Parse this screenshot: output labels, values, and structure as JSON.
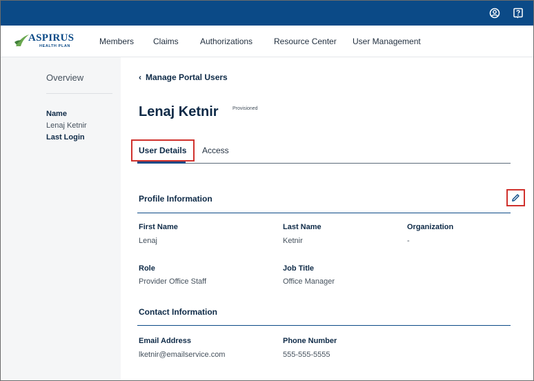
{
  "topbar": {
    "account_icon": "user-circle-icon",
    "help_icon": "help-icon",
    "color": "#0b4a87"
  },
  "brand": {
    "name": "ASPIRUS",
    "sub": "HEALTH PLAN"
  },
  "nav": {
    "items": [
      "Members",
      "Claims",
      "Authorizations",
      "Resource Center",
      "User Management"
    ]
  },
  "sidebar": {
    "overview": "Overview",
    "name_label": "Name",
    "name_value": "Lenaj Ketnir",
    "last_login_label": "Last Login"
  },
  "main": {
    "back_link": "Manage Portal Users",
    "user_name": "Lenaj Ketnir",
    "status_badge": "Provisioned",
    "tabs": [
      {
        "label": "User Details",
        "active": true
      },
      {
        "label": "Access",
        "active": false
      }
    ],
    "profile": {
      "title": "Profile Information",
      "edit_icon": "pencil-icon",
      "fields": {
        "first_name_label": "First Name",
        "first_name": "Lenaj",
        "last_name_label": "Last Name",
        "last_name": "Ketnir",
        "organization_label": "Organization",
        "organization": "-",
        "role_label": "Role",
        "role": "Provider Office Staff",
        "job_title_label": "Job Title",
        "job_title": "Office Manager"
      }
    },
    "contact": {
      "title": "Contact Information",
      "email_label": "Email Address",
      "email": "lketnir@emailservice.com",
      "phone_label": "Phone Number",
      "phone": "555-555-5555"
    }
  },
  "colors": {
    "brand_blue": "#0b4a87",
    "highlight_red": "#d0312d",
    "logo_green": "#6aa84f"
  }
}
